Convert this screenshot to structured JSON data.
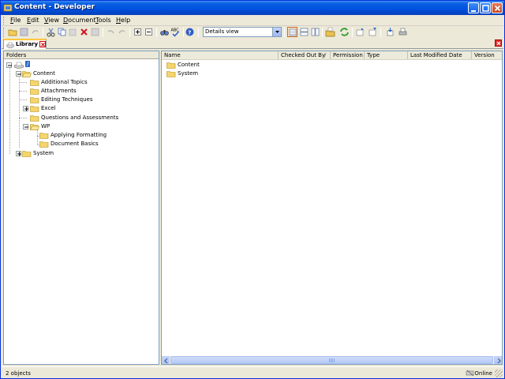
{
  "window": {
    "title": "Content - Developer"
  },
  "menu": [
    {
      "label": "File",
      "key": "F",
      "rest": "ile"
    },
    {
      "label": "Edit",
      "key": "E",
      "rest": "dit"
    },
    {
      "label": "View",
      "key": "V",
      "rest": "iew"
    },
    {
      "label": "Document",
      "key": "D",
      "rest": "ocument"
    },
    {
      "label": "Tools",
      "key": "T",
      "rest": "ools"
    },
    {
      "label": "Help",
      "key": "H",
      "rest": "elp"
    }
  ],
  "toolbar": {
    "view_select": "Details view",
    "icons": [
      "open-folder-icon",
      "save-icon",
      "redo-icon",
      "cut-icon",
      "copy-icon",
      "paste-icon",
      "delete-icon",
      "properties-icon",
      "undo-icon",
      "redo-icon",
      "expand-icon",
      "collapse-icon",
      "find-icon",
      "spellcheck-icon",
      "help-icon",
      "details-view-icon",
      "list-view-icon",
      "thumbnails-view-icon",
      "open-icon",
      "refresh-icon",
      "checkout-icon",
      "checkin-icon",
      "publish-icon",
      "print-icon"
    ]
  },
  "tabs": [
    {
      "label": "Library"
    }
  ],
  "folders": {
    "header": "Folders",
    "root": "/",
    "tree": [
      {
        "label": "Content",
        "depth": 1
      },
      {
        "label": "Additional Topics",
        "depth": 2
      },
      {
        "label": "Attachments",
        "depth": 2
      },
      {
        "label": "Editing Techniques",
        "depth": 2
      },
      {
        "label": "Excel",
        "depth": 2
      },
      {
        "label": "Questions and Assessments",
        "depth": 2
      },
      {
        "label": "WP",
        "depth": 2
      },
      {
        "label": "Applying Formatting",
        "depth": 3
      },
      {
        "label": "Document Basics",
        "depth": 3
      },
      {
        "label": "System",
        "depth": 1
      }
    ]
  },
  "list": {
    "columns": [
      "Name",
      "Checked Out By",
      "Permission",
      "Type",
      "Last Modified Date",
      "Version"
    ],
    "sort_indicator": "/",
    "rows": [
      "Content",
      "System"
    ]
  },
  "status": {
    "count": "2 objects",
    "connection": "Online"
  }
}
